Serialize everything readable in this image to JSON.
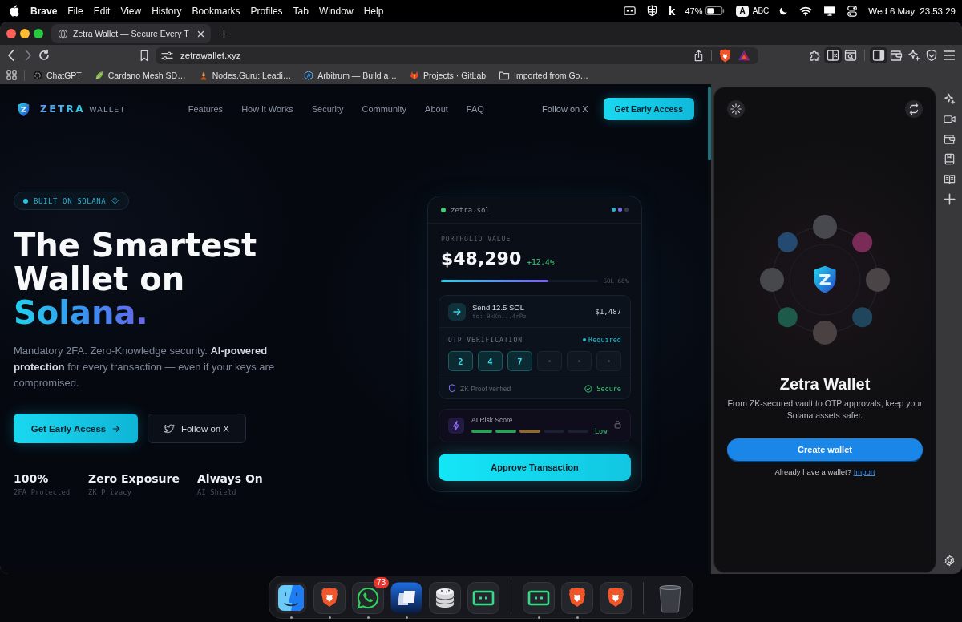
{
  "menu_bar": {
    "app_name": "Brave",
    "menus": [
      "File",
      "Edit",
      "View",
      "History",
      "Bookmarks",
      "Profiles",
      "Tab",
      "Window",
      "Help"
    ],
    "status_letter": "k",
    "battery_reading": "47%",
    "input_source": {
      "badge": "A",
      "label": "ABC"
    },
    "date": "Wed 6 May",
    "time": "23.53.29"
  },
  "browser": {
    "tabs": [
      {
        "title": "Zetra Wallet — Secure Every T",
        "selected": true
      }
    ],
    "address": "zetrawallet.xyz",
    "toolbar": {
      "left_group": [
        {
          "kind": "extensions",
          "on": false
        },
        {
          "kind": "split-view",
          "on": true
        },
        {
          "kind": "page-capture",
          "on": false
        }
      ],
      "right_group": [
        {
          "kind": "sidebar",
          "on": true
        },
        {
          "kind": "wallet",
          "on": false
        },
        {
          "kind": "assistant",
          "on": false
        },
        {
          "kind": "vpn",
          "on": false
        },
        {
          "kind": "menu",
          "on": false
        }
      ]
    },
    "bookmarks": [
      {
        "kind": "chatgpt",
        "label": "ChatGPT"
      },
      {
        "kind": "leaf",
        "label": "Cardano Mesh SD…"
      },
      {
        "kind": "figure",
        "label": "Nodes.Guru: Leadi…"
      },
      {
        "kind": "hexagon",
        "label": "Arbitrum — Build a…"
      },
      {
        "kind": "fox",
        "label": "Projects · GitLab"
      },
      {
        "kind": "folder",
        "label": "Imported from Go…"
      }
    ]
  },
  "page": {
    "brand": {
      "name": "ZETRA",
      "suffix": "WALLET"
    },
    "nav_links": [
      "Features",
      "How it Works",
      "Security",
      "Community",
      "About",
      "FAQ"
    ],
    "follow_link": "Follow on X",
    "cta": "Get Early Access",
    "hero": {
      "badge": "BUILT ON SOLANA",
      "title_lines": [
        "The Smartest",
        "Wallet on"
      ],
      "title_accent": "Solana.",
      "description": "Mandatory 2FA. Zero-Knowledge security. **AI-powered protection** for every transaction — even if your keys are compromised.",
      "buttons": [
        {
          "kind": "primary",
          "label": "Get Early Access"
        },
        {
          "kind": "secondary",
          "label": "Follow on X"
        }
      ],
      "stats": [
        {
          "value": "100%",
          "label": "2FA Protected"
        },
        {
          "value": "Zero Exposure",
          "label": "ZK Privacy"
        },
        {
          "value": "Always On",
          "label": "AI Shield"
        }
      ]
    },
    "wallet_card": {
      "account": "zetra.sol",
      "online": true,
      "indicator_dots": [
        {
          "color": "#2fb4d0"
        },
        {
          "color": "#7f6ff0"
        },
        {
          "color": "#343b48"
        }
      ],
      "portfolio_label": "PORTFOLIO VALUE",
      "portfolio_value": "$48,290",
      "change": "+12.4%",
      "allocation": {
        "level": 0.68,
        "reading": "SOL 68%"
      },
      "transaction": {
        "title": "Send 12.5 SOL",
        "recipient": "to: 9xKm...4rPz",
        "amount": "$1,487"
      },
      "otp": {
        "label": "OTP VERIFICATION",
        "status": "Required",
        "digits": [
          {
            "value": "2",
            "filled": true
          },
          {
            "value": "4",
            "filled": true
          },
          {
            "value": "7",
            "filled": true
          },
          {
            "filled": false
          },
          {
            "filled": false
          },
          {
            "filled": false
          }
        ]
      },
      "proof": "ZK Proof verified",
      "security": "Secure",
      "risk": {
        "label": "AI Risk Score",
        "segments": [
          {
            "color": "#2e9e5b"
          },
          {
            "color": "#2e9e5b"
          },
          {
            "color": "#8c6a38"
          },
          {
            "color": "#1b2130"
          },
          {
            "color": "#1b2130"
          }
        ],
        "reading": "Low"
      },
      "approve_button": "Approve Transaction"
    }
  },
  "wallet_panel": {
    "orbit": [
      {
        "color": "#48494e"
      },
      {
        "color": "#7a2b57"
      },
      {
        "color": "#4b4446"
      },
      {
        "color": "#1f465d"
      },
      {
        "color": "#4a4143"
      },
      {
        "color": "#1d5a4a"
      },
      {
        "color": "#46484c"
      },
      {
        "color": "#244a72"
      }
    ],
    "title": "Zetra Wallet",
    "description": "From ZK-secured vault to OTP approvals, keep your Solana assets safer.",
    "create_button": "Create wallet",
    "import_prompt": "Already have a wallet?",
    "import_link": "Import"
  },
  "dock": {
    "groups": [
      {
        "apps": [
          {
            "kind": "finder",
            "running": true
          },
          {
            "kind": "brave",
            "running": true
          },
          {
            "kind": "whatsapp",
            "running": true,
            "badge": "73"
          },
          {
            "kind": "cards",
            "running": true
          },
          {
            "kind": "database",
            "running": false
          },
          {
            "kind": "terminal",
            "running": false
          }
        ]
      },
      {
        "apps": [
          {
            "kind": "terminal",
            "running": true
          },
          {
            "kind": "brave",
            "running": true
          },
          {
            "kind": "brave",
            "running": false
          }
        ]
      },
      {
        "apps": [
          {
            "kind": "trash",
            "running": false
          }
        ]
      }
    ]
  }
}
